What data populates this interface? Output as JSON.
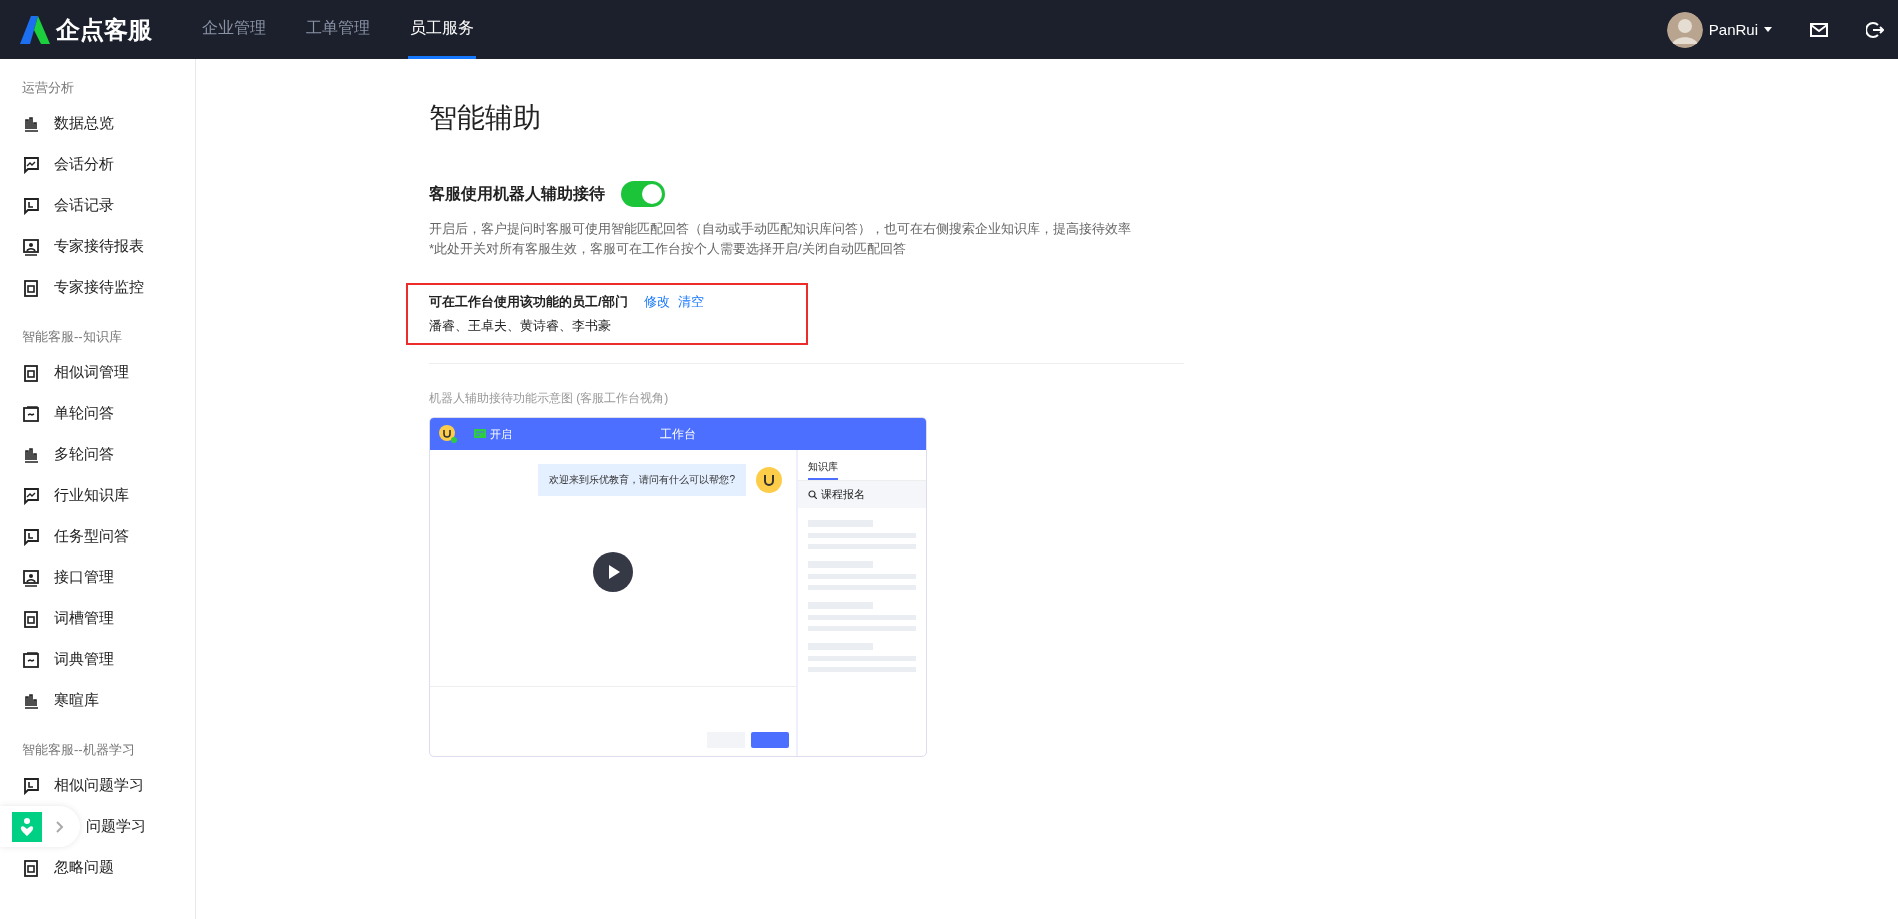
{
  "header": {
    "brand": "企点客服",
    "nav": [
      {
        "label": "企业管理",
        "selected": false
      },
      {
        "label": "工单管理",
        "selected": false
      },
      {
        "label": "员工服务",
        "selected": true
      }
    ],
    "user": "PanRui"
  },
  "sidebar": [
    {
      "title": "运营分析",
      "items": [
        "数据总览",
        "会话分析",
        "会话记录",
        "专家接待报表",
        "专家接待监控"
      ]
    },
    {
      "title": "智能客服--知识库",
      "items": [
        "相似词管理",
        "单轮问答",
        "多轮问答",
        "行业知识库",
        "任务型问答",
        "接口管理",
        "词槽管理",
        "词典管理",
        "寒暄库"
      ]
    },
    {
      "title": "智能客服--机器学习",
      "items": [
        {
          "label": "相似问题学习",
          "covered": false
        },
        {
          "label": "问题学习",
          "covered": true
        },
        {
          "label": "忽略问题",
          "covered": false
        }
      ]
    }
  ],
  "page": {
    "title": "智能辅助",
    "setting": {
      "label": "客服使用机器人辅助接待",
      "on": true
    },
    "description": [
      "开启后，客户提问时客服可使用智能匹配回答（自动或手动匹配知识库问答），也可在右侧搜索企业知识库，提高接待效率",
      "*此处开关对所有客服生效，客服可在工作台按个人需要选择开启/关闭自动匹配回答"
    ],
    "scope": {
      "label": "可在工作台使用该功能的员工/部门",
      "actions": [
        "修改",
        "清空"
      ],
      "members": "潘睿、王卓夫、黄诗睿、李书豪"
    },
    "demo": {
      "caption": "机器人辅助接待功能示意图 (客服工作台视角)",
      "status": "开启",
      "title": "工作台",
      "message": "欢迎来到乐优教育，请问有什么可以帮您?",
      "tab": "知识库",
      "search": "课程报名"
    }
  }
}
